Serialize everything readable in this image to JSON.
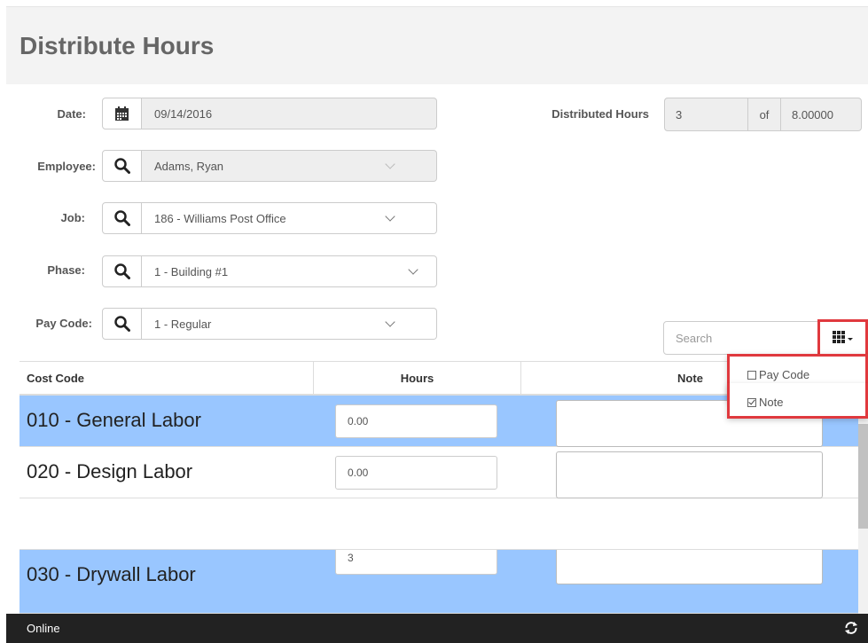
{
  "page": {
    "title": "Distribute Hours"
  },
  "form": {
    "date_label": "Date:",
    "date_value": "09/14/2016",
    "employee_label": "Employee:",
    "employee_value": "Adams, Ryan",
    "job_label": "Job:",
    "job_value": "186 - Williams Post Office",
    "phase_label": "Phase:",
    "phase_value": "1 - Building #1",
    "paycode_label": "Pay Code:",
    "paycode_value": "1 - Regular"
  },
  "distributed": {
    "label": "Distributed Hours",
    "value": "3",
    "of_label": "of",
    "total": "8.00000"
  },
  "search": {
    "placeholder": "Search"
  },
  "column_menu": {
    "items": [
      {
        "label": "Pay Code",
        "checked": false
      },
      {
        "label": "Note",
        "checked": true
      }
    ]
  },
  "table": {
    "headers": [
      "Cost Code",
      "Hours",
      "Note"
    ],
    "rows": [
      {
        "cost_code": "010 - General Labor",
        "hours": "0.00",
        "note": ""
      },
      {
        "cost_code": "020 - Design Labor",
        "hours": "0.00",
        "note": ""
      },
      {
        "cost_code": "030 - Drywall Labor",
        "hours": "3",
        "note": ""
      }
    ]
  },
  "footer": {
    "status": "Online"
  },
  "colors": {
    "row_highlight": "#99c6ff",
    "callout": "#e0393e",
    "footer_bg": "#222222"
  },
  "icons": [
    "calendar-icon",
    "search-icon",
    "chevron-down-icon",
    "grid-columns-icon",
    "refresh-icon"
  ]
}
